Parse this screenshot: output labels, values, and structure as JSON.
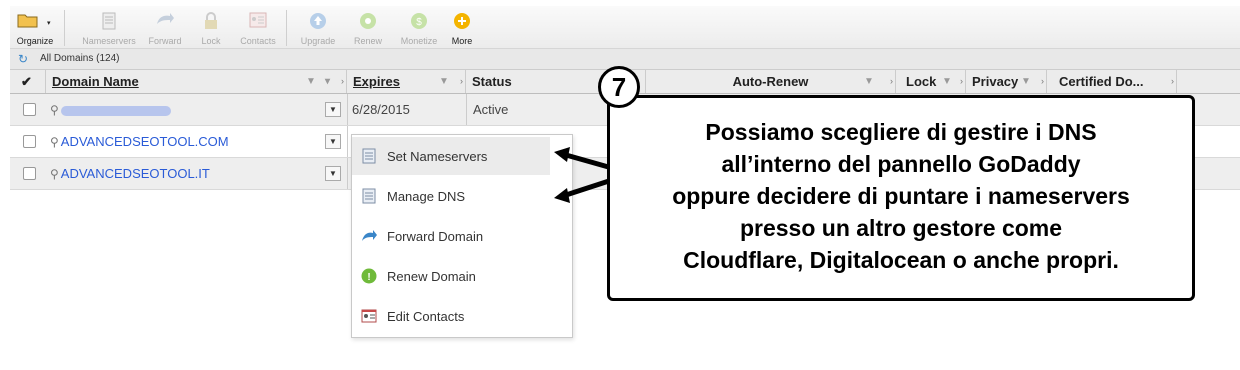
{
  "toolbar": {
    "items": [
      {
        "label": "Organize",
        "icon": "folder-icon",
        "enabled": true
      },
      {
        "label": "Nameservers",
        "icon": "nameservers-icon",
        "enabled": false
      },
      {
        "label": "Forward",
        "icon": "forward-icon",
        "enabled": false
      },
      {
        "label": "Lock",
        "icon": "lock-icon",
        "enabled": false
      },
      {
        "label": "Contacts",
        "icon": "contacts-icon",
        "enabled": false
      },
      {
        "label": "Upgrade",
        "icon": "upgrade-icon",
        "enabled": false
      },
      {
        "label": "Renew",
        "icon": "renew-icon",
        "enabled": false
      },
      {
        "label": "Monetize",
        "icon": "monetize-icon",
        "enabled": false
      },
      {
        "label": "More",
        "icon": "more-icon",
        "enabled": true
      }
    ]
  },
  "subbar": {
    "text": "All Domains (124)"
  },
  "columns": {
    "domain": "Domain Name",
    "expires": "Expires",
    "status": "Status",
    "autorenew": "Auto-Renew",
    "lock": "Lock",
    "privacy": "Privacy",
    "certified": "Certified Do..."
  },
  "rows": [
    {
      "domain": "",
      "expires": "6/28/2015",
      "status": "Active"
    },
    {
      "domain": "ADVANCEDSEOTOOL.COM",
      "expires": "",
      "status": ""
    },
    {
      "domain": "ADVANCEDSEOTOOL.IT",
      "expires": "",
      "status": ""
    }
  ],
  "menu": {
    "items": [
      {
        "label": "Set Nameservers",
        "icon": "nameservers-doc-icon"
      },
      {
        "label": "Manage DNS",
        "icon": "dns-doc-icon"
      },
      {
        "label": "Forward Domain",
        "icon": "forward-arrow-icon"
      },
      {
        "label": "Renew Domain",
        "icon": "renew-circle-icon"
      },
      {
        "label": "Edit Contacts",
        "icon": "contacts-card-icon"
      }
    ]
  },
  "callout": {
    "number": "7",
    "lines": [
      "Possiamo scegliere di gestire i DNS",
      "all’interno del pannello GoDaddy",
      "oppure decidere di puntare i nameservers",
      "presso un altro gestore come",
      "Cloudflare, Digitalocean o anche propri."
    ]
  },
  "colors": {
    "link": "#2a5bd7",
    "accent": "#3a86c8",
    "renew": "#7cc142",
    "more": "#f4b400"
  }
}
